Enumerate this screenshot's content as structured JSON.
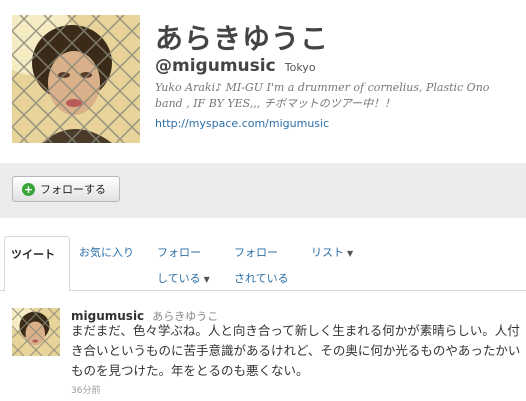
{
  "profile": {
    "display_name": "あらきゆうこ",
    "handle": "@migumusic",
    "location": "Tokyo",
    "bio": "Yuko Araki♪ MI-GU I'm a drummer of cornelius, Plastic Ono band , IF BY YES,,, チボマットのツアー中！！",
    "url": "http://myspace.com/migumusic"
  },
  "follow_button": {
    "label": "フォローする",
    "icon": "plus-icon"
  },
  "tabs": [
    {
      "label": "ツイート",
      "active": true
    },
    {
      "label": "お気に入り"
    },
    {
      "label_line1": "フォロー",
      "label_line2": "している"
    },
    {
      "label_line1": "フォロー",
      "label_line2": "されている"
    },
    {
      "label": "リスト"
    }
  ],
  "tweet": {
    "username": "migumusic",
    "display_name": "あらきゆうこ",
    "text": "まだまだ、色々学ぶね。人と向き合って新しく生まれる何かが素晴らしい。人付き合いというものに苦手意識があるけれど、その奥に何か光るものやあったかいものを見つけた。年をとるのも悪くない。",
    "time": "36分前"
  },
  "colors": {
    "link": "#2b6fa8",
    "follow_bar": "#ececec",
    "plus_icon": "#3aa53a"
  }
}
